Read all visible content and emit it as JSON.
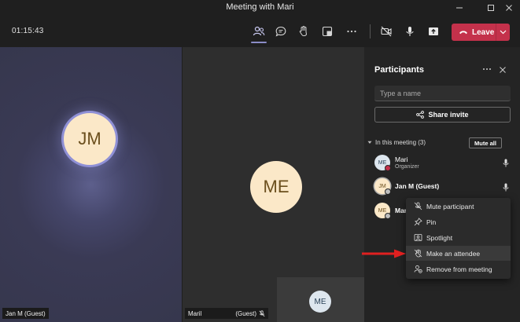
{
  "window": {
    "title": "Meeting with Mari",
    "controls": [
      "minimize",
      "maximize",
      "close"
    ]
  },
  "toolbar": {
    "timer": "01:15:43",
    "buttons": [
      "participants-icon",
      "chat-icon",
      "raise-hand-icon",
      "share-tray-icon",
      "more-icon",
      "camera-off-icon",
      "mic-icon",
      "share-screen-icon"
    ],
    "leave_label": "Leave",
    "leave_color": "#c4314b"
  },
  "stage": {
    "left_tile": {
      "initials": "JM",
      "name_tag": "Jan M (Guest)"
    },
    "right_tile": {
      "initials": "ME",
      "name_tag": "Maril",
      "name_suffix": "(Guest)"
    },
    "self_view": {
      "initials": "ME"
    }
  },
  "panel": {
    "title": "Participants",
    "search_placeholder": "Type a name",
    "share_invite_label": "Share invite",
    "section_label": "In this meeting (3)",
    "mute_all_label": "Mute all",
    "participants": [
      {
        "initials": "ME",
        "name": "Mari",
        "role": "Organizer",
        "status_color": "#c4314b"
      },
      {
        "initials": "JM",
        "name": "Jan M (Guest)",
        "role": "",
        "status_color": "#8a8a8a"
      },
      {
        "initials": "ME",
        "name": "Mar",
        "role": "",
        "status_color": "#8a8a8a"
      }
    ]
  },
  "context_menu": {
    "items": [
      {
        "label": "Mute participant",
        "icon": "mic-off-icon"
      },
      {
        "label": "Pin",
        "icon": "pin-icon"
      },
      {
        "label": "Spotlight",
        "icon": "spotlight-icon"
      },
      {
        "label": "Make an attendee",
        "icon": "hand-off-icon",
        "highlighted": true
      },
      {
        "label": "Remove from meeting",
        "icon": "remove-person-icon"
      }
    ]
  },
  "colors": {
    "accent": "#8b8cc7",
    "annotation_arrow": "#e02020"
  }
}
